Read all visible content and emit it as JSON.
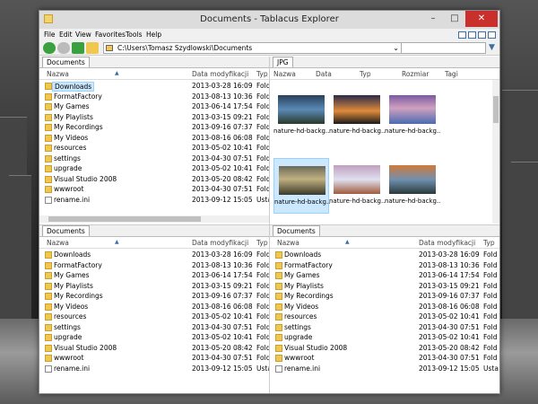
{
  "window": {
    "title": "Documents - Tablacus Explorer"
  },
  "menu": [
    "File",
    "Edit",
    "View",
    "Favorites",
    "Tools",
    "Help"
  ],
  "address": {
    "path": "C:\\Users\\Tomasz Szydlowski\\Documents"
  },
  "columns": {
    "name": "Nazwa",
    "date": "Data modyfikacji",
    "type": "Typ"
  },
  "pane_tl": {
    "tab": "Documents"
  },
  "pane_bl": {
    "tab": "Documents"
  },
  "pane_br": {
    "tab": "Documents"
  },
  "pane_tr": {
    "tab": "JPG",
    "columns": {
      "name": "Nazwa",
      "date": "Data",
      "type": "Typ",
      "size": "Rozmiar",
      "tags": "Tagi"
    },
    "thumbs": [
      "nature-hd-backg...",
      "nature-hd-backg...",
      "nature-hd-backg...",
      "nature-hd-backg...",
      "nature-hd-backg...",
      "nature-hd-backg..."
    ]
  },
  "files": [
    {
      "name": "Downloads",
      "date": "2013-03-28 16:09",
      "type": "Fold",
      "kind": "folder"
    },
    {
      "name": "FormatFactory",
      "date": "2013-08-13 10:36",
      "type": "Fold",
      "kind": "folder"
    },
    {
      "name": "My Games",
      "date": "2013-06-14 17:54",
      "type": "Fold",
      "kind": "folder"
    },
    {
      "name": "My Playlists",
      "date": "2013-03-15 09:21",
      "type": "Fold",
      "kind": "folder"
    },
    {
      "name": "My Recordings",
      "date": "2013-09-16 07:37",
      "type": "Fold",
      "kind": "folder"
    },
    {
      "name": "My Videos",
      "date": "2013-08-16 06:08",
      "type": "Fold",
      "kind": "folder"
    },
    {
      "name": "resources",
      "date": "2013-05-02 10:41",
      "type": "Fold",
      "kind": "folder"
    },
    {
      "name": "settings",
      "date": "2013-04-30 07:51",
      "type": "Fold",
      "kind": "folder"
    },
    {
      "name": "upgrade",
      "date": "2013-05-02 10:41",
      "type": "Fold",
      "kind": "folder"
    },
    {
      "name": "Visual Studio 2008",
      "date": "2013-05-20 08:42",
      "type": "Fold",
      "kind": "folder"
    },
    {
      "name": "wwwroot",
      "date": "2013-04-30 07:51",
      "type": "Fold",
      "kind": "folder"
    },
    {
      "name": "rename.ini",
      "date": "2013-09-12 15:05",
      "type": "Usta",
      "kind": "file"
    }
  ]
}
